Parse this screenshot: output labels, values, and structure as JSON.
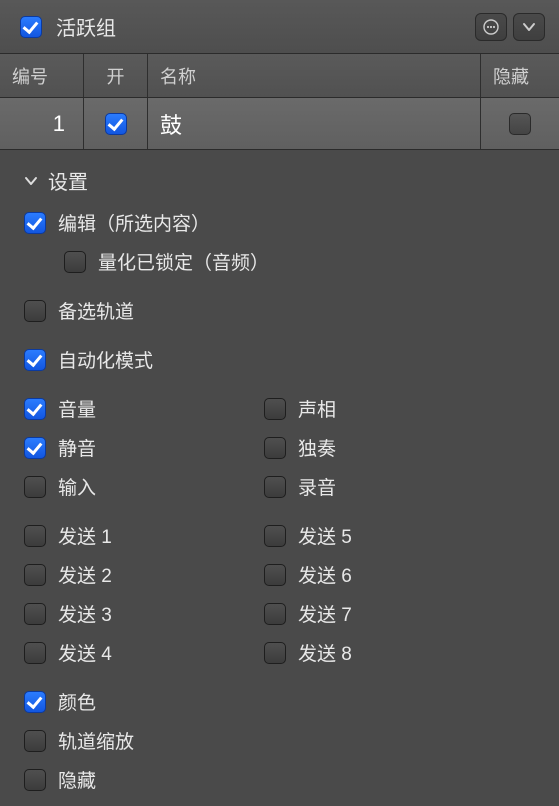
{
  "topbar": {
    "active_group_label": "活跃组",
    "active_group_checked": true
  },
  "columns": {
    "number": "编号",
    "on": "开",
    "name": "名称",
    "hide": "隐藏"
  },
  "row": {
    "number": "1",
    "on_checked": true,
    "name": "鼓",
    "hide_checked": false
  },
  "settings": {
    "title": "设置",
    "edit": {
      "label": "编辑（所选内容）",
      "checked": true
    },
    "quantize_locked": {
      "label": "量化已锁定（音频）",
      "checked": false
    },
    "alt_track": {
      "label": "备选轨道",
      "checked": false
    },
    "automation_mode": {
      "label": "自动化模式",
      "checked": true
    },
    "mix_left": [
      {
        "key": "volume",
        "label": "音量",
        "checked": true
      },
      {
        "key": "mute",
        "label": "静音",
        "checked": true
      },
      {
        "key": "input",
        "label": "输入",
        "checked": false
      }
    ],
    "mix_right": [
      {
        "key": "pan",
        "label": "声相",
        "checked": false
      },
      {
        "key": "solo",
        "label": "独奏",
        "checked": false
      },
      {
        "key": "record",
        "label": "录音",
        "checked": false
      }
    ],
    "sends_left": [
      {
        "key": "send1",
        "label": "发送 1",
        "checked": false
      },
      {
        "key": "send2",
        "label": "发送 2",
        "checked": false
      },
      {
        "key": "send3",
        "label": "发送 3",
        "checked": false
      },
      {
        "key": "send4",
        "label": "发送 4",
        "checked": false
      }
    ],
    "sends_right": [
      {
        "key": "send5",
        "label": "发送 5",
        "checked": false
      },
      {
        "key": "send6",
        "label": "发送 6",
        "checked": false
      },
      {
        "key": "send7",
        "label": "发送 7",
        "checked": false
      },
      {
        "key": "send8",
        "label": "发送 8",
        "checked": false
      }
    ],
    "color": {
      "label": "颜色",
      "checked": true
    },
    "track_zoom": {
      "label": "轨道缩放",
      "checked": false
    },
    "hide": {
      "label": "隐藏",
      "checked": false
    }
  }
}
